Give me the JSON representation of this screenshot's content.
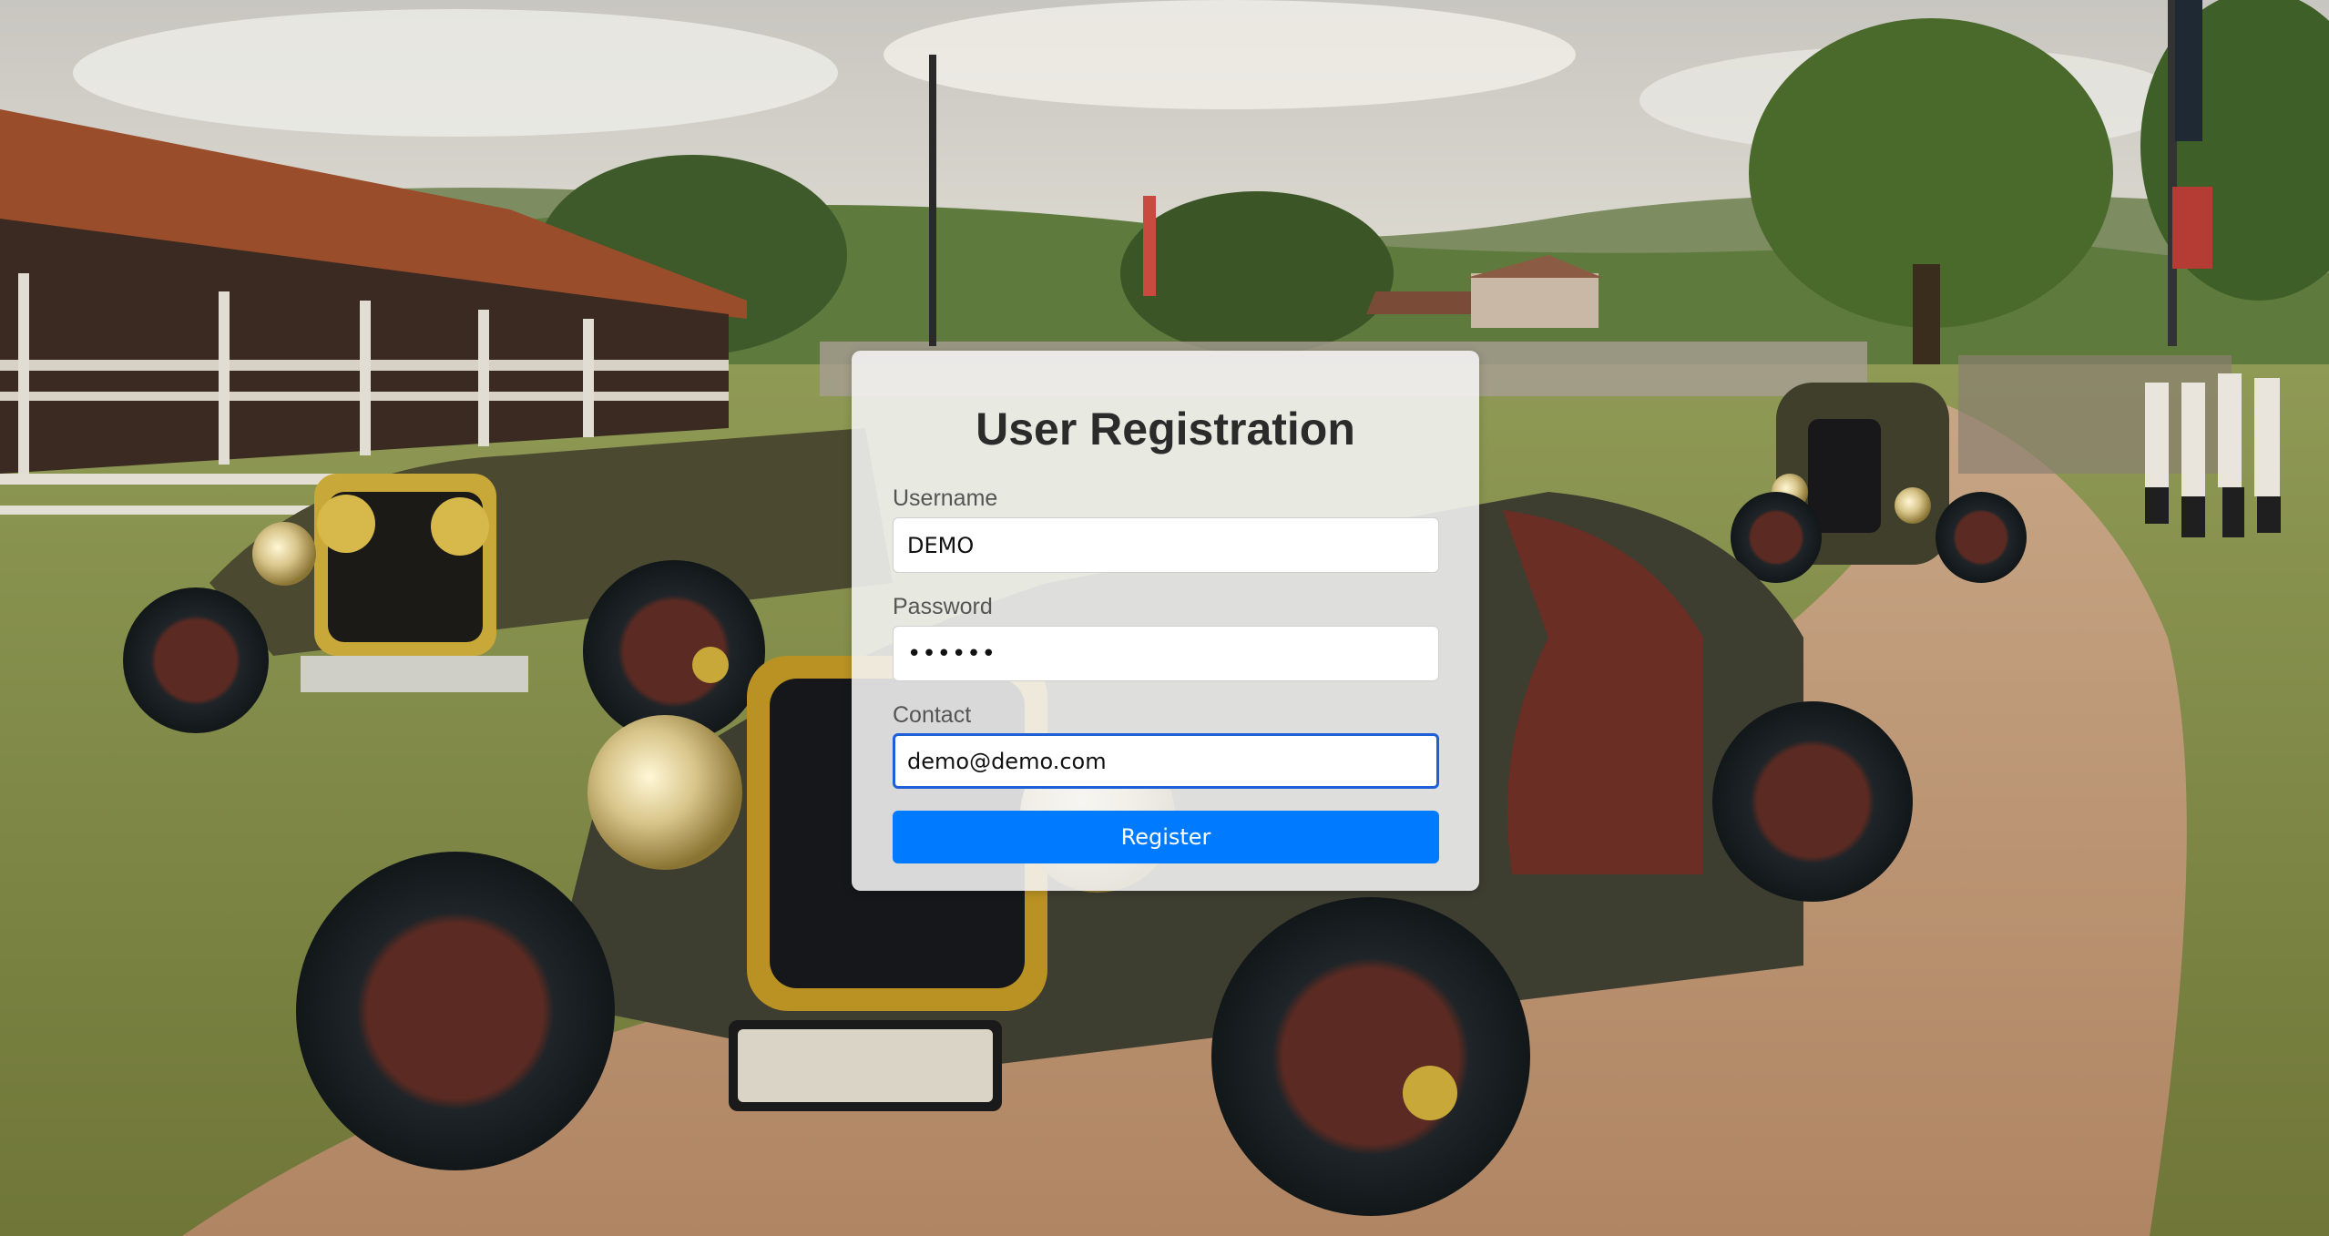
{
  "background": {
    "scene": "vintage roadster cars on dirt track in countryside"
  },
  "form": {
    "title": "User Registration",
    "username": {
      "label": "Username",
      "value": "DEMO"
    },
    "password": {
      "label": "Password",
      "value": "••••••"
    },
    "contact": {
      "label": "Contact",
      "value": "demo@demo.com"
    },
    "submit_label": "Register"
  },
  "colors": {
    "accent": "#007bff",
    "focus_border": "#1c5fd6",
    "title": "#2b2b2b",
    "label": "#555555"
  }
}
